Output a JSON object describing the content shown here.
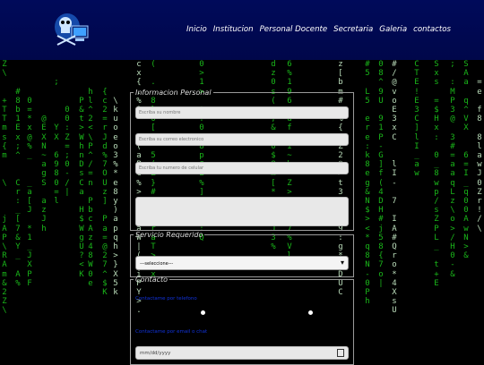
{
  "nav": {
    "items": [
      "Inicio",
      "Institucion",
      "Personal Docente",
      "Secretaria",
      "Galeria",
      "contactos"
    ]
  },
  "logo": {
    "icon": "skull-computer-logo"
  },
  "form": {
    "info_legend": "Informacion Personal",
    "name_placeholder": "Escriba su nombre",
    "email_placeholder": "Escriba su correo electronico",
    "phone_placeholder": "Escriba tu      numero de celular",
    "service_legend": "Servicio Requerido",
    "service_selected": "---seleccione---",
    "contact_legend": "Contacto",
    "contact_link_1": "Contactame por telefono",
    "contact_link_2": "Contactame por email o chat",
    "date_value": "mm/dd/yyyy"
  },
  "colors": {
    "header_bg": "#000a5a",
    "matrix_green": "#1fd61f",
    "link_blue": "#1133dd"
  }
}
